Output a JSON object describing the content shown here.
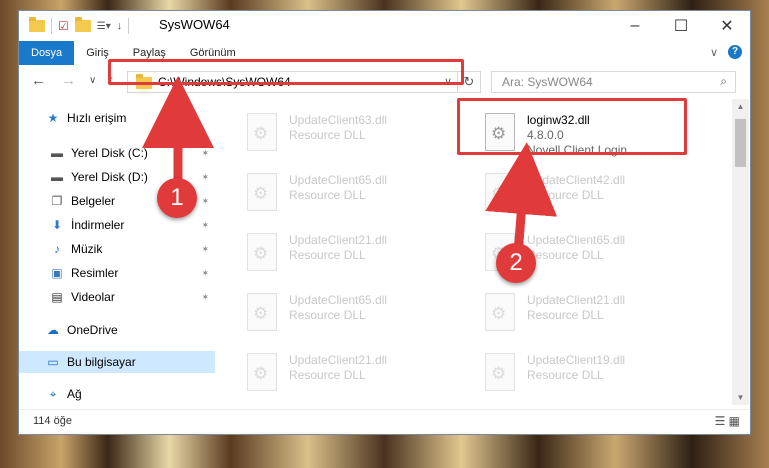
{
  "window": {
    "title": "SysWOW64"
  },
  "controls": {
    "minimize": "–",
    "maximize": "☐",
    "close": "✕"
  },
  "ribbon": {
    "tabs": [
      "Dosya",
      "Giriş",
      "Paylaş",
      "Görünüm"
    ],
    "active_tab": "Dosya",
    "collapse": "∨",
    "help": "?"
  },
  "nav": {
    "back": "←",
    "forward": "→",
    "recent": "∨",
    "up": "↑",
    "address": "C:\\Windows\\SysWOW64",
    "address_chevron": "∨",
    "refresh": "↻",
    "search_placeholder": "Ara: SysWOW64",
    "search_icon": "⌕"
  },
  "sidebar": {
    "items": [
      {
        "label": "Hızlı erişim",
        "icon": "star-icon",
        "glyph": "★",
        "color": "#2f78d0",
        "pinned": false
      },
      {
        "label": "Yerel Disk (C:)",
        "icon": "drive-icon",
        "glyph": "▬",
        "color": "#555",
        "pinned": true
      },
      {
        "label": "Yerel Disk (D:)",
        "icon": "drive-icon",
        "glyph": "▬",
        "color": "#555",
        "pinned": true
      },
      {
        "label": "Belgeler",
        "icon": "document-icon",
        "glyph": "❐",
        "color": "#555",
        "pinned": true
      },
      {
        "label": "İndirmeler",
        "icon": "download-icon",
        "glyph": "⬇",
        "color": "#2f78d0",
        "pinned": true
      },
      {
        "label": "Müzik",
        "icon": "music-icon",
        "glyph": "♪",
        "color": "#2f78d0",
        "pinned": true
      },
      {
        "label": "Resimler",
        "icon": "pictures-icon",
        "glyph": "▣",
        "color": "#3a7ab8",
        "pinned": true
      },
      {
        "label": "Videolar",
        "icon": "video-icon",
        "glyph": "▤",
        "color": "#333",
        "pinned": true
      },
      {
        "label": "OneDrive",
        "icon": "cloud-icon",
        "glyph": "☁",
        "color": "#1f6fc5",
        "pinned": false
      },
      {
        "label": "Bu bilgisayar",
        "icon": "computer-icon",
        "glyph": "▭",
        "color": "#1f6fc5",
        "pinned": false,
        "selected": true
      },
      {
        "label": "Ağ",
        "icon": "network-icon",
        "glyph": "⌖",
        "color": "#1f6fc5",
        "pinned": false
      }
    ],
    "pin_glyph": "✶"
  },
  "files": [
    {
      "name": "UpdateClient63.dll",
      "type": "Resource DLL",
      "dim": true
    },
    {
      "name": "loginw32.dll",
      "version": "4.8.0.0",
      "type": "Novell Client Login...",
      "dim": false
    },
    {
      "name": "UpdateClient65.dll",
      "type": "Resource DLL",
      "dim": true
    },
    {
      "name": "UpdateClient42.dll",
      "type": "Resource DLL",
      "dim": true
    },
    {
      "name": "UpdateClient21.dll",
      "type": "Resource DLL",
      "dim": true
    },
    {
      "name": "UpdateClient65.dll",
      "type": "Resource DLL",
      "dim": true
    },
    {
      "name": "UpdateClient65.dll",
      "type": "Resource DLL",
      "dim": true
    },
    {
      "name": "UpdateClient21.dll",
      "type": "Resource DLL",
      "dim": true
    },
    {
      "name": "UpdateClient21.dll",
      "type": "Resource DLL",
      "dim": true
    },
    {
      "name": "UpdateClient19.dll",
      "type": "Resource DLL",
      "dim": true
    }
  ],
  "status": {
    "count": "114 öğe",
    "views": "☰ ▦"
  },
  "scroll": {
    "up": "▲",
    "down": "▼"
  },
  "annotations": {
    "step1": "1",
    "step2": "2",
    "accent": "#e03a3a"
  }
}
